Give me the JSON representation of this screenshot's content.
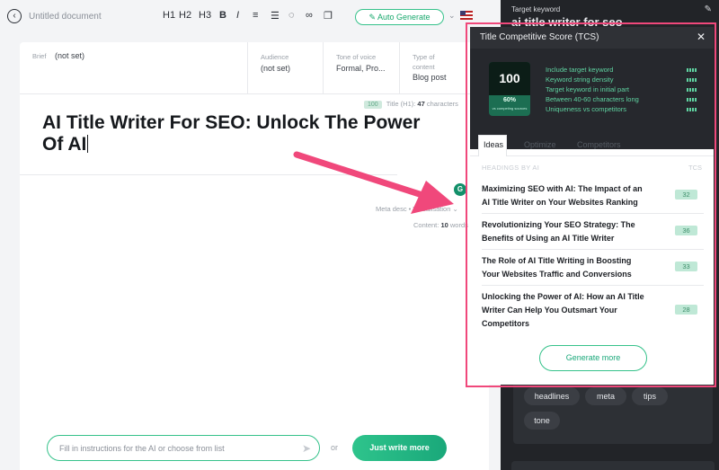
{
  "toolbar": {
    "back_icon": "arrow-left-icon",
    "doc_title": "Untitled document",
    "h1": "H1",
    "h2": "H2",
    "h3": "H3",
    "bold": "B",
    "italic": "I",
    "auto_generate": "Auto Generate",
    "language_flag": "us-flag-icon"
  },
  "meta": {
    "brief_label": "Brief",
    "brief_value": "(not set)",
    "audience_label": "Audience",
    "audience_value": "(not set)",
    "tone_label": "Tone of voice",
    "tone_value": "Formal, Pro...",
    "type_label_1": "Type of",
    "type_label_2": "content",
    "type_value": "Blog post"
  },
  "title_info": {
    "badge": "100",
    "label": "Title (H1):",
    "count": "47",
    "unit": "characters"
  },
  "document": {
    "h1_line1": "AI Title Writer For SEO: Unlock The Power",
    "h1_line2": "Of AI",
    "meta_desc": "Meta desc • Visualisation",
    "content_label": "Content:",
    "content_count": "10",
    "content_unit": "words"
  },
  "prompt": {
    "placeholder": "Fill in instructions for the AI or choose from list",
    "or": "or",
    "write_button": "Just write more"
  },
  "sidebar": {
    "target_keyword_label": "Target keyword",
    "target_keyword": "ai title writer for seo",
    "chips": [
      "headlines",
      "meta",
      "tips",
      "tone"
    ]
  },
  "panel": {
    "title": "Title Competitive Score (TCS)",
    "close": "✕",
    "score": "100",
    "score_pct": "60%",
    "score_sub": "vs competing sources",
    "criteria": [
      "Include target keyword",
      "Keyword string density",
      "Target keyword in initial part",
      "Between 40-60 characters long",
      "Uniqueness vs competitors"
    ],
    "tabs": [
      "Ideas",
      "Optimize",
      "Competitors"
    ],
    "section_heading": "HEADINGS BY AI",
    "section_tcs": "TCS",
    "ideas": [
      {
        "line1": "Maximizing SEO with AI: The Impact of an",
        "line2": "AI Title Writer on Your Websites Ranking",
        "line3": "",
        "score": "32"
      },
      {
        "line1": "Revolutionizing Your SEO Strategy: The",
        "line2": "Benefits of Using an AI Title Writer",
        "line3": "",
        "score": "36"
      },
      {
        "line1": "The Role of AI Title Writing in Boosting",
        "line2": "Your Websites Traffic and Conversions",
        "line3": "",
        "score": "33"
      },
      {
        "line1": "Unlocking the Power of AI: How an AI Title",
        "line2": "Writer Can Help You Outsmart Your",
        "line3": "Competitors",
        "score": "28"
      }
    ],
    "generate_more": "Generate more"
  },
  "colors": {
    "accent": "#36c28b",
    "highlight": "#f0487b",
    "dark": "#222428"
  }
}
